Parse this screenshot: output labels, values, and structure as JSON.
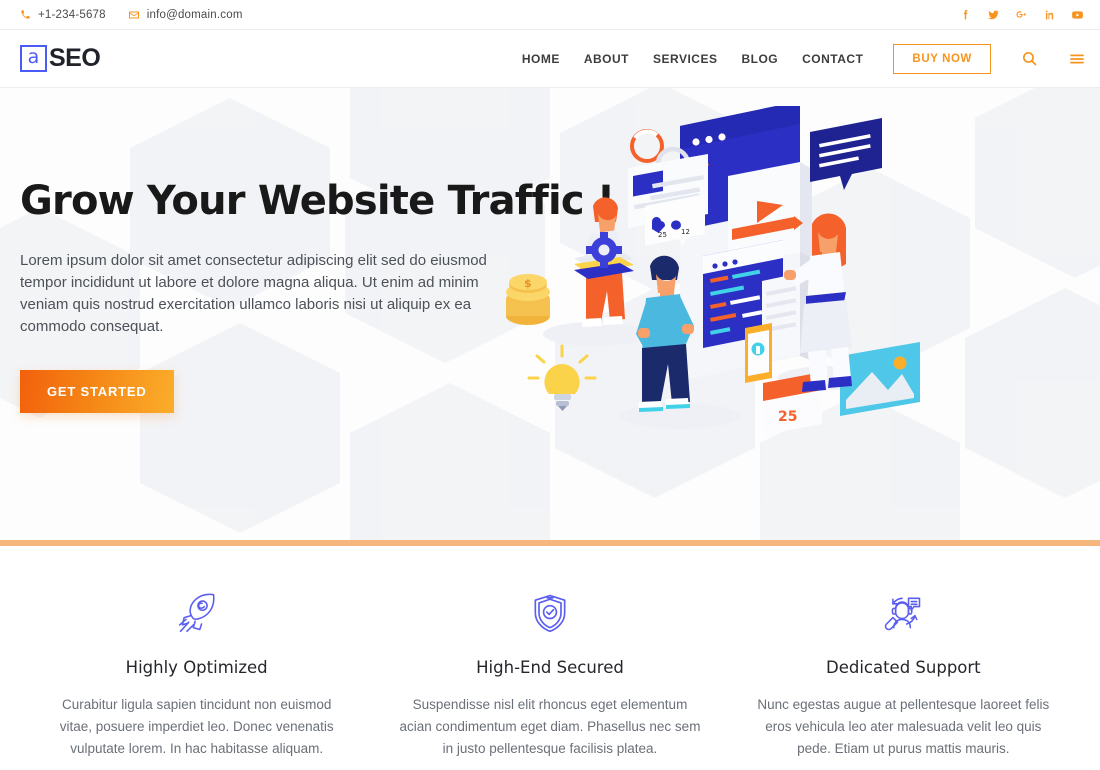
{
  "topbar": {
    "phone": "+1-234-5678",
    "phone_icon": "phone-icon",
    "email": "info@domain.com",
    "email_icon": "envelope-icon",
    "socials": [
      {
        "name": "facebook-icon",
        "label": "f"
      },
      {
        "name": "twitter-icon",
        "label": "t"
      },
      {
        "name": "google-plus-icon",
        "label": "G+"
      },
      {
        "name": "linkedin-icon",
        "label": "in"
      },
      {
        "name": "youtube-icon",
        "label": "yt"
      }
    ]
  },
  "header": {
    "logo_mark": "a",
    "logo_text": "SEO",
    "nav": [
      {
        "label": "HOME"
      },
      {
        "label": "ABOUT"
      },
      {
        "label": "SERVICES"
      },
      {
        "label": "BLOG"
      },
      {
        "label": "CONTACT"
      }
    ],
    "buy_label": "BUY NOW",
    "search_icon": "search-icon",
    "menu_icon": "hamburger-menu-icon"
  },
  "hero": {
    "title": "Grow Your Website Traffic !",
    "description": "Lorem ipsum dolor sit amet consectetur adipiscing elit sed do eiusmod tempor incididunt ut labore et dolore magna aliqua. Ut enim ad minim veniam quis nostrud exercitation ullamco laboris nisi ut aliquip ex ea commodo consequat.",
    "cta_label": "GET STARTED",
    "illustration": "isometric-seo-team-illustration",
    "illustration_calendar_number": "25",
    "illustration_like_count": "25",
    "illustration_comment_count": "12"
  },
  "features": [
    {
      "icon": "rocket-icon",
      "title": "Highly Optimized",
      "text": "Curabitur ligula sapien tincidunt non euismod vitae, posuere imperdiet leo. Donec venenatis vulputate lorem. In hac habitasse aliquam."
    },
    {
      "icon": "shield-check-icon",
      "title": "High-End Secured",
      "text": "Suspendisse nisl elit rhoncus eget elementum acian condimentum eget diam. Phasellus nec sem in justo pellentesque facilisis platea."
    },
    {
      "icon": "support-agent-icon",
      "title": "Dedicated Support",
      "text": "Nunc egestas augue at pellentesque laoreet felis eros vehicula leo ater malesuada velit leo quis pede. Etiam ut purus mattis mauris."
    }
  ],
  "colors": {
    "accent_orange": "#f7941e",
    "cta_gradient_start": "#f2600c",
    "cta_gradient_end": "#fbae2a",
    "divider": "#f6b77e",
    "logo_blue": "#4a5cf5",
    "feature_icon": "#5a5ef0",
    "heading": "#191919"
  }
}
